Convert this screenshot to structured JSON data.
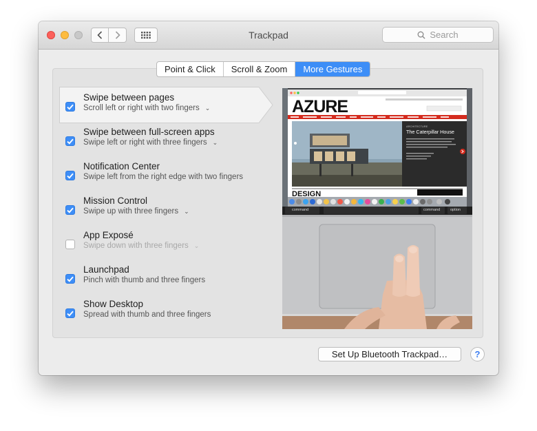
{
  "window": {
    "title": "Trackpad"
  },
  "search": {
    "placeholder": "Search"
  },
  "tabs": [
    {
      "label": "Point & Click",
      "active": false
    },
    {
      "label": "Scroll & Zoom",
      "active": false
    },
    {
      "label": "More Gestures",
      "active": true
    }
  ],
  "gestures": [
    {
      "title": "Swipe between pages",
      "subtitle": "Scroll left or right with two fingers",
      "checked": true,
      "has_menu": true
    },
    {
      "title": "Swipe between full-screen apps",
      "subtitle": "Swipe left or right with three fingers",
      "checked": true,
      "has_menu": true
    },
    {
      "title": "Notification Center",
      "subtitle": "Swipe left from the right edge with two fingers",
      "checked": true,
      "has_menu": false
    },
    {
      "title": "Mission Control",
      "subtitle": "Swipe up with three fingers",
      "checked": true,
      "has_menu": true
    },
    {
      "title": "App Exposé",
      "subtitle": "Swipe down with three fingers",
      "checked": false,
      "has_menu": true
    },
    {
      "title": "Launchpad",
      "subtitle": "Pinch with thumb and three fingers",
      "checked": true,
      "has_menu": false
    },
    {
      "title": "Show Desktop",
      "subtitle": "Spread with thumb and three fingers",
      "checked": true,
      "has_menu": false
    }
  ],
  "preview": {
    "logo": "AZURE",
    "category": "ARCHITECTURE",
    "headline": "The Caterpillar House",
    "section": "DESIGN",
    "keys": {
      "left": "command",
      "middle": "command",
      "right": "option"
    }
  },
  "buttons": {
    "setup": "Set Up Bluetooth Trackpad…",
    "help": "?"
  },
  "colors": {
    "accent": "#3d8ef7",
    "azure_red": "#d42b1e"
  }
}
